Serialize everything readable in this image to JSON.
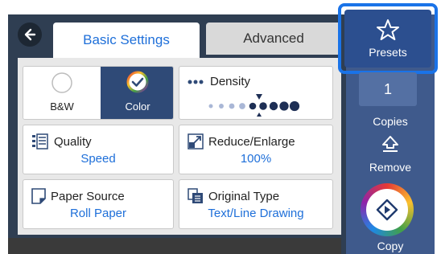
{
  "tabs": {
    "basic": "Basic Settings",
    "advanced": "Advanced"
  },
  "color_mode": {
    "bw_label": "B&W",
    "color_label": "Color",
    "selected": "Color"
  },
  "density": {
    "title": "Density",
    "level": 4,
    "max": 9
  },
  "quality": {
    "title": "Quality",
    "value": "Speed"
  },
  "reduce_enlarge": {
    "title": "Reduce/Enlarge",
    "value": "100%"
  },
  "paper_source": {
    "title": "Paper Source",
    "value": "Roll Paper"
  },
  "original_type": {
    "title": "Original Type",
    "value": "Text/Line Drawing"
  },
  "sidebar": {
    "presets_label": "Presets",
    "copies_value": "1",
    "copies_label": "Copies",
    "remove_label": "Remove",
    "copy_label": "Copy"
  },
  "icons": {
    "back": "back-arrow-icon",
    "presets": "star-icon",
    "remove": "eject-icon",
    "copy": "start-diamond-icon",
    "quality": "quality-icon",
    "reduce_enlarge": "resize-icon",
    "paper_source": "paper-icon",
    "original_type": "document-type-icon"
  },
  "colors": {
    "accent": "#1e6fd9",
    "panel": "#2f3e52",
    "sidebar": "#3f5a8c",
    "highlight": "#1a73e8"
  }
}
